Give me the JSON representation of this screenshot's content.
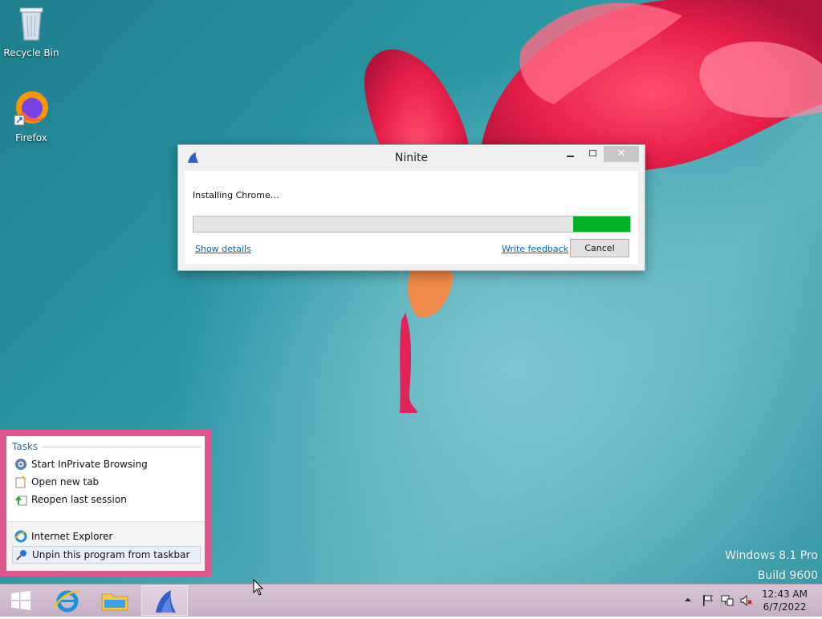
{
  "desktop": {
    "icons": [
      {
        "label": "Recycle Bin",
        "icon": "recycle-bin-icon"
      },
      {
        "label": "Firefox",
        "icon": "firefox-icon"
      }
    ],
    "watermark": {
      "line1": "Windows 8.1 Pro",
      "line2": "Build 9600"
    }
  },
  "ninite": {
    "title": "Ninite",
    "status": "Installing Chrome…",
    "progress_percent": 13,
    "show_details": "Show details",
    "write_feedback": "Write feedback",
    "cancel": "Cancel",
    "colors": {
      "progress_fill": "#06b025",
      "link": "#0b63b5"
    }
  },
  "jumplist": {
    "tasks_header": "Tasks",
    "tasks": [
      {
        "label": "Start InPrivate Browsing",
        "icon": "inprivate-icon"
      },
      {
        "label": "Open new tab",
        "icon": "new-tab-icon"
      },
      {
        "label": "Reopen last session",
        "icon": "reopen-session-icon"
      }
    ],
    "app_name": "Internet Explorer",
    "unpin": "Unpin this program from taskbar",
    "colors": {
      "border": "#e0558e",
      "header": "#3d6b9e"
    }
  },
  "taskbar": {
    "buttons": [
      {
        "name": "start-button",
        "icon": "windows-logo-icon"
      },
      {
        "name": "internet-explorer-button",
        "icon": "ie-icon"
      },
      {
        "name": "file-explorer-button",
        "icon": "folder-icon"
      },
      {
        "name": "ninite-button",
        "icon": "ninite-icon"
      }
    ],
    "clock": {
      "time": "12:43 AM",
      "date": "6/7/2022"
    }
  }
}
